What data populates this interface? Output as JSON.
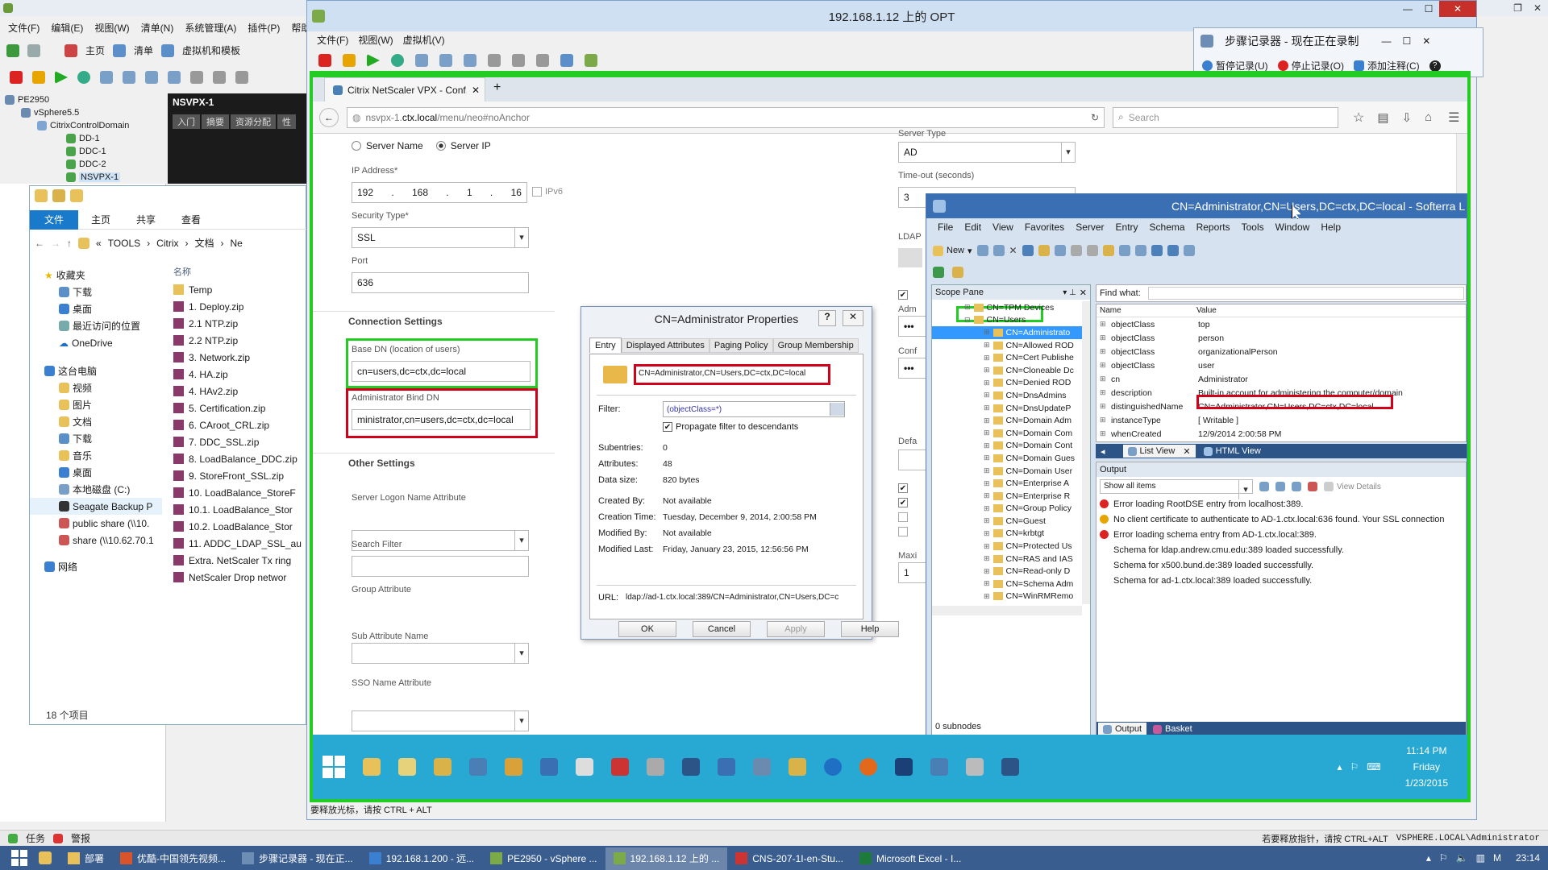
{
  "vsphere": {
    "menu": [
      "文件(F)",
      "编辑(E)",
      "视图(W)",
      "清单(N)",
      "系统管理(A)",
      "插件(P)",
      "帮助"
    ],
    "nav": [
      "主页",
      "清单",
      "虚拟机和模板"
    ],
    "tree": [
      "PE2950",
      "vSphere5.5",
      "CitrixControlDomain",
      "DD-1",
      "DDC-1",
      "DDC-2",
      "NSVPX-1"
    ],
    "vm_title": "NSVPX-1",
    "vm_tabs": [
      "入门",
      "摘要",
      "资源分配",
      "性"
    ],
    "status_bar": [
      "任务",
      "警报"
    ]
  },
  "explorer": {
    "ribbon_tabs": [
      "文件",
      "主页",
      "共享",
      "查看"
    ],
    "breadcrumb": [
      "«",
      "TOOLS",
      "Citrix",
      "文档",
      "Ne"
    ],
    "column_name": "名称",
    "nav": [
      "收藏夹",
      "下载",
      "桌面",
      "最近访问的位置",
      "OneDrive",
      "这台电脑",
      "视频",
      "图片",
      "文档",
      "下载",
      "音乐",
      "桌面",
      "本地磁盘 (C:)",
      "Seagate Backup P",
      "public share (\\\\10.",
      "share (\\\\10.62.70.1",
      "网络"
    ],
    "files": [
      "Temp",
      "1. Deploy.zip",
      "2.1 NTP.zip",
      "2.2 NTP.zip",
      "3. Network.zip",
      "4. HA.zip",
      "4. HAv2.zip",
      "5. Certification.zip",
      "6. CAroot_CRL.zip",
      "7. DDC_SSL.zip",
      "8. LoadBalance_DDC.zip",
      "9. StoreFront_SSL.zip",
      "10. LoadBalance_StoreF",
      "10.1. LoadBalance_Stor",
      "10.2. LoadBalance_Stor",
      "11. ADDC_LDAP_SSL_au",
      "Extra. NetScaler Tx ring",
      "NetScaler Drop networ"
    ],
    "count": "18 个项目"
  },
  "opt": {
    "title": "192.168.1.12 上的 OPT",
    "menu": [
      "文件(F)",
      "视图(W)",
      "虚拟机(V)"
    ],
    "status": "要释放光标，请按 CTRL + ALT"
  },
  "stepsrec": {
    "title": "步骤记录器 - 现在正在录制",
    "pause": "暂停记录(U)",
    "stop": "停止记录(O)",
    "comment": "添加注释(C)"
  },
  "browser": {
    "tab": "Citrix NetScaler VPX - Conf...",
    "url_pre": "nsvpx-1.",
    "url_host": "ctx.local",
    "url_post": "/menu/neo#noAnchor",
    "search": "Search"
  },
  "form": {
    "radio_server_name": "Server Name",
    "radio_server_ip": "Server IP",
    "ip_label": "IP Address*",
    "ip": [
      "192",
      "168",
      "1",
      "16"
    ],
    "ipv6": "IPv6",
    "security_type_label": "Security Type*",
    "security_type": "SSL",
    "port_label": "Port",
    "port": "636",
    "connection_settings": "Connection Settings",
    "base_dn_label": "Base DN (location of users)",
    "base_dn": "cn=users,dc=ctx,dc=local",
    "bind_dn_label": "Administrator Bind DN",
    "bind_dn": "ministrator,cn=users,dc=ctx,dc=local",
    "other_settings": "Other Settings",
    "logon_attr": "Server Logon Name Attribute",
    "search_filter": "Search Filter",
    "group_attr": "Group Attribute",
    "sub_attr": "Sub Attribute Name",
    "sso_attr": "SSO Name Attribute",
    "server_type_label": "Server Type",
    "server_type": "AD",
    "timeout_label": "Time-out (seconds)",
    "timeout": "3",
    "right_frag": [
      "LDAP",
      "Adm",
      "Conf",
      "Defa",
      "Maxi",
      "1"
    ],
    "password_dots": "•••"
  },
  "props": {
    "title": "CN=Administrator Properties",
    "help": "?",
    "close": "✕",
    "tabs": [
      "Entry",
      "Displayed Attributes",
      "Paging Policy",
      "Group Membership"
    ],
    "dn": "CN=Administrator,CN=Users,DC=ctx,DC=local",
    "filter_label": "Filter:",
    "filter": "(objectClass=*)",
    "propagate": "Propagate filter to descendants",
    "fields": [
      {
        "k": "Subentries:",
        "v": "0"
      },
      {
        "k": "Attributes:",
        "v": "48"
      },
      {
        "k": "Data size:",
        "v": "820 bytes"
      },
      {
        "k": "Created By:",
        "v": "Not available"
      },
      {
        "k": "Creation Time:",
        "v": "Tuesday, December 9, 2014, 2:00:58 PM"
      },
      {
        "k": "Modified By:",
        "v": "Not available"
      },
      {
        "k": "Modified Last:",
        "v": "Friday, January 23, 2015, 12:56:56 PM"
      }
    ],
    "url_label": "URL:",
    "url": "ldap://ad-1.ctx.local:389/CN=Administrator,CN=Users,DC=c",
    "buttons": [
      "OK",
      "Cancel",
      "Apply",
      "Help"
    ]
  },
  "softerra": {
    "title": "CN=Administrator,CN=Users,DC=ctx,DC=local - Softerra L",
    "menu": [
      "File",
      "Edit",
      "View",
      "Favorites",
      "Server",
      "Entry",
      "Schema",
      "Reports",
      "Tools",
      "Window",
      "Help"
    ],
    "new": "New",
    "scope_title": "Scope Pane",
    "scope": [
      "CN=TPM Devices",
      "CN=Users",
      "CN=Administrato",
      "CN=Allowed ROD",
      "CN=Cert Publishe",
      "CN=Cloneable Dc",
      "CN=Denied ROD",
      "CN=DnsAdmins",
      "CN=DnsUpdateP",
      "CN=Domain Adm",
      "CN=Domain Com",
      "CN=Domain Cont",
      "CN=Domain Gues",
      "CN=Domain User",
      "CN=Enterprise A",
      "CN=Enterprise R",
      "CN=Group Policy",
      "CN=Guest",
      "CN=krbtgt",
      "CN=Protected Us",
      "CN=RAS and IAS",
      "CN=Read-only D",
      "CN=Schema Adm",
      "CN=WinRMRemo"
    ],
    "find_label": "Find what:",
    "col_name": "Name",
    "col_value": "Value",
    "attrs": [
      {
        "n": "objectClass",
        "v": "top"
      },
      {
        "n": "objectClass",
        "v": "person"
      },
      {
        "n": "objectClass",
        "v": "organizationalPerson"
      },
      {
        "n": "objectClass",
        "v": "user"
      },
      {
        "n": "cn",
        "v": "Administrator"
      },
      {
        "n": "description",
        "v": "Built-in account for administering the computer/domain"
      },
      {
        "n": "distinguishedName",
        "v": "CN=Administrator,CN=Users,DC=ctx,DC=local"
      },
      {
        "n": "instanceType",
        "v": "[ Writable ]"
      },
      {
        "n": "whenCreated",
        "v": "12/9/2014 2:00:58 PM"
      }
    ],
    "view_tabs": [
      "List View",
      "HTML View"
    ],
    "output_title": "Output",
    "output_filter": "Show all items",
    "view_details": "View Details",
    "output": [
      {
        "t": "Error loading RootDSE entry from localhost:389.",
        "k": "err"
      },
      {
        "t": "No client certificate to authenticate to AD-1.ctx.local:636 found. Your SSL connection",
        "k": "warn"
      },
      {
        "t": "Error loading schema entry from AD-1.ctx.local:389.",
        "k": "err"
      },
      {
        "t": "Schema for ldap.andrew.cmu.edu:389 loaded successfully.",
        "k": "ok"
      },
      {
        "t": "Schema for x500.bund.de:389 loaded successfully.",
        "k": "ok"
      },
      {
        "t": "Schema for ad-1.ctx.local:389 loaded successfully.",
        "k": "ok"
      }
    ],
    "bottom_tabs": [
      "Output",
      "Basket"
    ],
    "status": "0 subnodes"
  },
  "inner_clock": {
    "time": "11:14 PM",
    "day": "Friday",
    "date": "1/23/2015"
  },
  "outer_status": {
    "right": "若要释放指针，请按 CTRL+ALT",
    "user": "VSPHERE.LOCAL\\Administrator"
  },
  "host_taskbar": {
    "items": [
      "部署",
      "优酷-中国领先视频...",
      "步骤记录器 - 现在正...",
      "192.168.1.200 - 远...",
      "PE2950 - vSphere ...",
      "192.168.1.12 上的 ...",
      "CNS-207-1I-en-Stu...",
      "Microsoft Excel - I..."
    ],
    "time": "23:14"
  },
  "colors": {
    "accent_green": "#22cc22",
    "highlight_red": "#d0021b",
    "win_blue": "#3b7fd1",
    "taskbar_teal": "#28a9d3"
  }
}
